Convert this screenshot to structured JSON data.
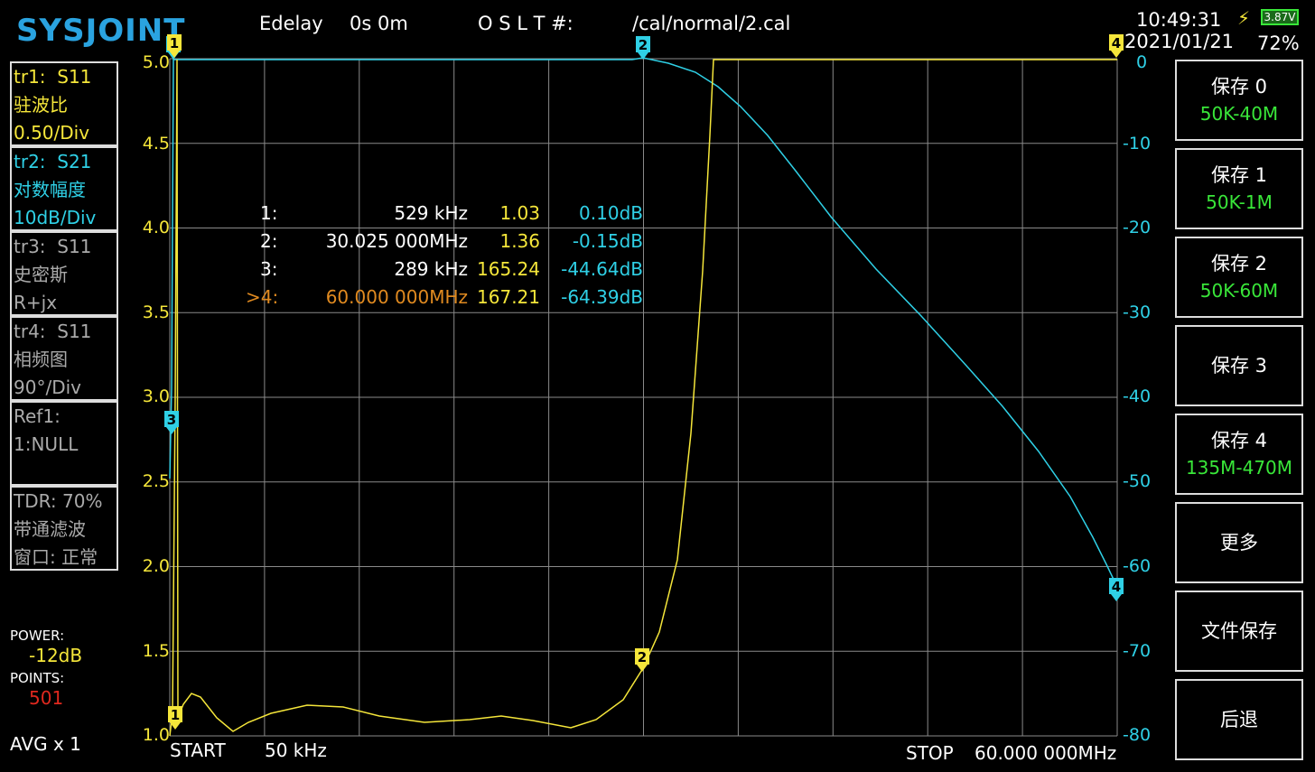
{
  "header": {
    "logo": "SYSJOINT",
    "edelay_label": "Edelay",
    "edelay_value": "0s 0m",
    "oslt_label": "O S L T #:",
    "oslt_value": "/cal/normal/2.cal",
    "time": "10:49:31",
    "battery_voltage": "3.87V",
    "date": "2021/01/21",
    "battery_percent": "72%"
  },
  "traces": [
    {
      "id": "tr1:",
      "param": "S11",
      "format": "驻波比",
      "scale": "0.50/Div",
      "color": "#f5e63a"
    },
    {
      "id": "tr2:",
      "param": "S21",
      "format": "对数幅度",
      "scale": "10dB/Div",
      "color": "#2fd0e6"
    },
    {
      "id": "tr3:",
      "param": "S11",
      "format": "史密斯",
      "scale": "R+jx",
      "color": "#aaaaaa"
    },
    {
      "id": "tr4:",
      "param": "S11",
      "format": "相频图",
      "scale": "90°/Div",
      "color": "#aaaaaa"
    }
  ],
  "ref": {
    "label": "Ref1:",
    "value": "1:NULL"
  },
  "tdr": {
    "line1": "TDR: 70%",
    "line2": "带通滤波",
    "line3": "窗口: 正常"
  },
  "status": {
    "power_label": "POWER:",
    "power_value": "-12dB",
    "points_label": "POINTS:",
    "points_value": "501",
    "avg": "AVG x 1"
  },
  "axis_left": [
    "5.0",
    "4.5",
    "4.0",
    "3.5",
    "3.0",
    "2.5",
    "2.0",
    "1.5",
    "1.0"
  ],
  "axis_right": [
    "0",
    "-10",
    "-20",
    "-30",
    "-40",
    "-50",
    "-60",
    "-70",
    "-80"
  ],
  "freq": {
    "start_label": "START",
    "start_value": "50 kHz",
    "stop_label": "STOP",
    "stop_value": "60.000 000MHz"
  },
  "markers": [
    {
      "id": "1:",
      "freq": "529 kHz",
      "swr": "1.03",
      "s21": "0.10dB"
    },
    {
      "id": "2:",
      "freq": "30.025 000MHz",
      "swr": "1.36",
      "s21": "-0.15dB"
    },
    {
      "id": "3:",
      "freq": "289 kHz",
      "swr": "165.24",
      "s21": "-44.64dB"
    },
    {
      "id": ">4:",
      "freq": "60.000 000MHz",
      "swr": "167.21",
      "s21": "-64.39dB"
    }
  ],
  "marker_flags": [
    "1",
    "2",
    "3",
    "4"
  ],
  "buttons": [
    {
      "title": "保存 0",
      "sub": "50K-40M"
    },
    {
      "title": "保存 1",
      "sub": "50K-1M"
    },
    {
      "title": "保存 2",
      "sub": "50K-60M"
    },
    {
      "title": "保存 3",
      "sub": ""
    },
    {
      "title": "保存 4",
      "sub": "135M-470M"
    },
    {
      "title": "更多",
      "sub": ""
    },
    {
      "title": "文件保存",
      "sub": ""
    },
    {
      "title": "后退",
      "sub": ""
    }
  ],
  "colors": {
    "swr": "#f5e63a",
    "s21": "#2fd0e6",
    "grid": "#8a8a8a",
    "active_marker": "#e08a20"
  }
}
